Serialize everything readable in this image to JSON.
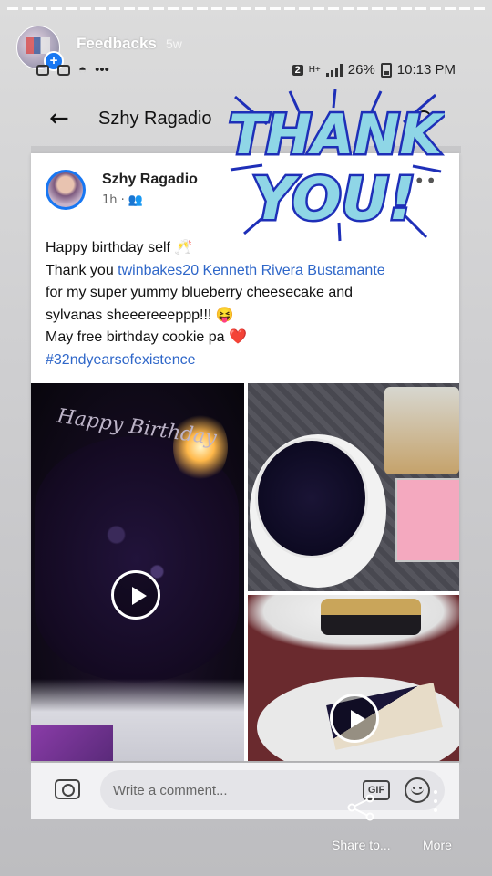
{
  "story": {
    "name": "Feedbacks",
    "age": "5w",
    "share_label": "Share to...",
    "more_label": "More"
  },
  "status_bar": {
    "sim": "2",
    "network": "H+",
    "battery": "26%",
    "time": "10:13 PM"
  },
  "app": {
    "title": "Szhy Ragadio"
  },
  "post": {
    "author": "Szhy Ragadio",
    "time": "1h",
    "line1": "Happy birthday self 🥂",
    "line2_prefix": "Thank you ",
    "line2_links": "twinbakes20 Kenneth Rivera Bustamante",
    "line3": "for my super yummy blueberry cheesecake and",
    "line4": "sylvanas sheeereeeppp!!! 😝",
    "line5": "May free birthday cookie pa ❤️",
    "hashtag": "#32ndyearsofexistence",
    "cake_writing": "Happy Birthday"
  },
  "comment": {
    "placeholder": "Write a comment...",
    "gif_label": "GIF"
  },
  "sticker": {
    "line1": "THANK",
    "line2": "YOU!"
  },
  "colors": {
    "facebook_blue": "#1877f2",
    "link": "#2f67c9",
    "sticker_fill": "#8fd6e6",
    "sticker_splash": "#1e2fb8"
  }
}
